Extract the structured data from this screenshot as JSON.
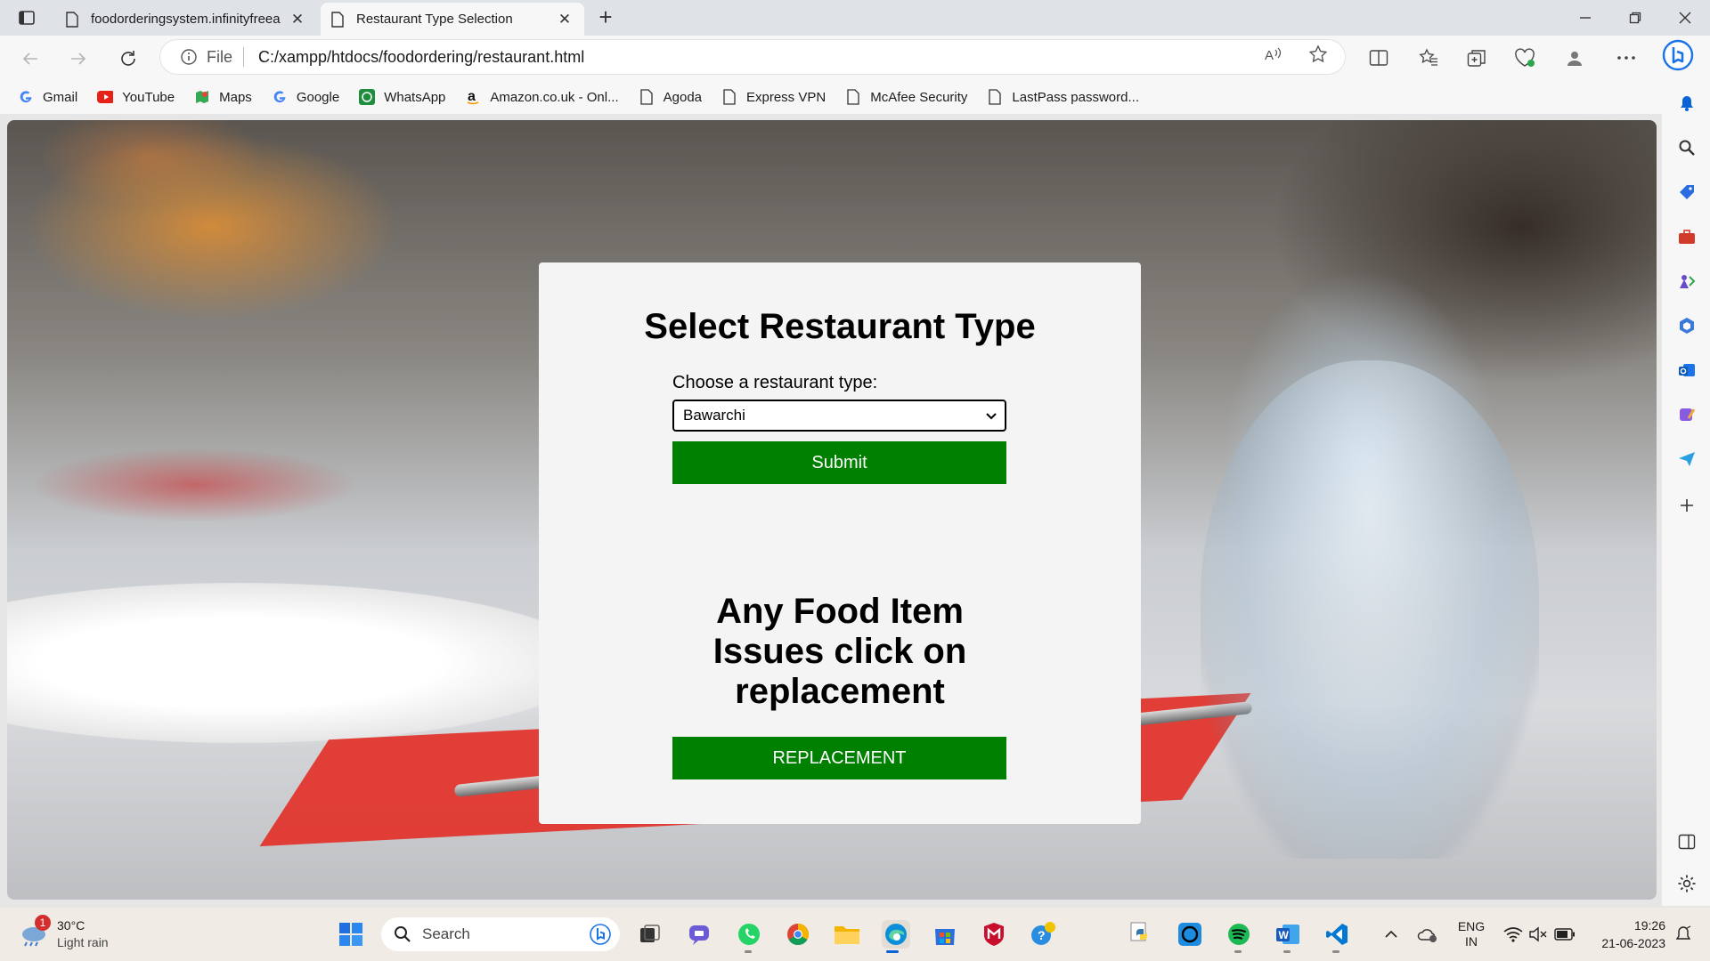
{
  "browser": {
    "tabs": [
      {
        "title": "foodorderingsystem.infinityfreea",
        "active": false
      },
      {
        "title": "Restaurant Type Selection",
        "active": true
      }
    ],
    "address": {
      "scheme_label": "File",
      "url": "C:/xampp/htdocs/foodordering/restaurant.html"
    },
    "favorites": [
      {
        "label": "Gmail",
        "icon": "google-icon"
      },
      {
        "label": "YouTube",
        "icon": "youtube-icon"
      },
      {
        "label": "Maps",
        "icon": "maps-icon"
      },
      {
        "label": "Google",
        "icon": "google-icon"
      },
      {
        "label": "WhatsApp",
        "icon": "whatsapp-icon"
      },
      {
        "label": "Amazon.co.uk - Onl...",
        "icon": "amazon-icon"
      },
      {
        "label": "Agoda",
        "icon": "document-icon"
      },
      {
        "label": "Express VPN",
        "icon": "document-icon"
      },
      {
        "label": "McAfee Security",
        "icon": "document-icon"
      },
      {
        "label": "LastPass password...",
        "icon": "document-icon"
      }
    ]
  },
  "page": {
    "heading": "Select Restaurant Type",
    "select_label": "Choose a restaurant type:",
    "selected_option": "Bawarchi",
    "submit_label": "Submit",
    "issue_heading": "Any Food Item Issues click on replacement",
    "replacement_label": "REPLACEMENT"
  },
  "taskbar": {
    "weather": {
      "temp": "30°C",
      "condition": "Light rain",
      "badge": "1"
    },
    "search_placeholder": "Search",
    "language": {
      "line1": "ENG",
      "line2": "IN"
    },
    "time": "19:26",
    "date": "21-06-2023"
  },
  "colors": {
    "accent_green": "#008000",
    "card_bg": "#f4f4f4",
    "edge_blue": "#0a64d6"
  }
}
